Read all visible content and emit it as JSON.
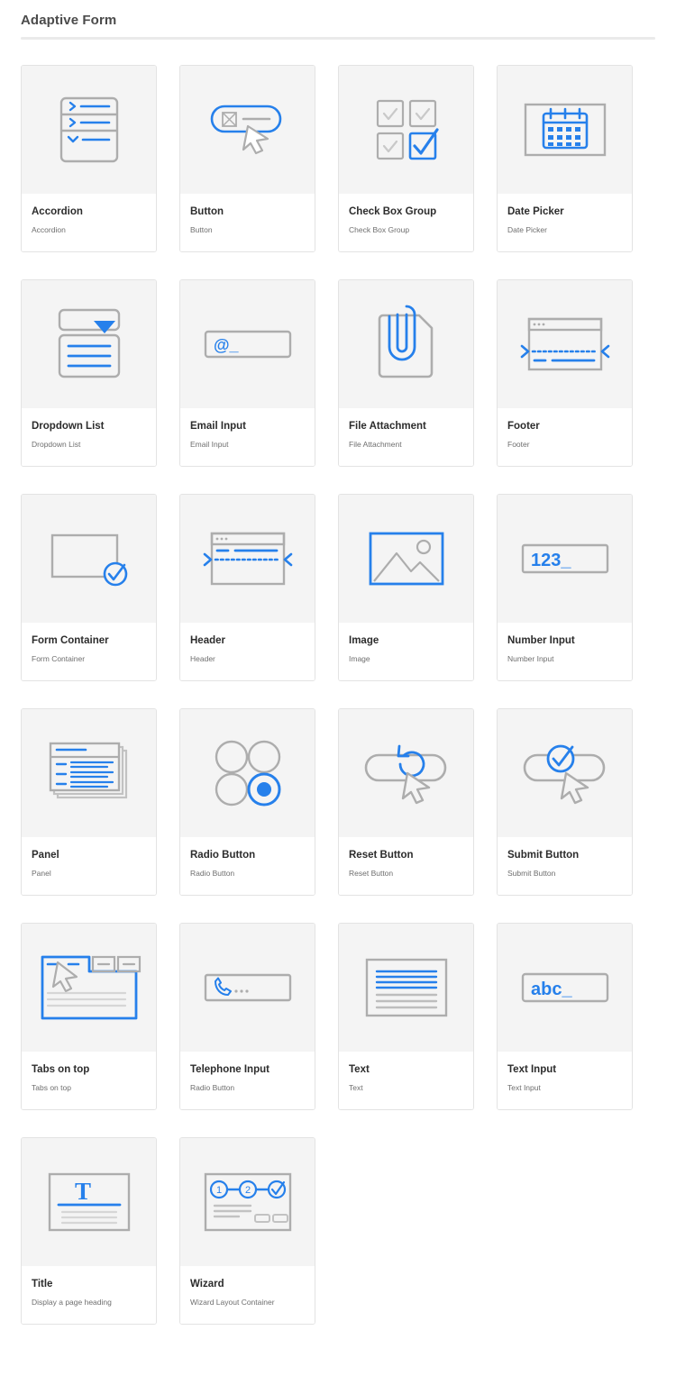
{
  "header": {
    "title": "Adaptive Form"
  },
  "components": [
    {
      "name": "Accordion",
      "description": "Accordion",
      "icon": "accordion-icon"
    },
    {
      "name": "Button",
      "description": "Button",
      "icon": "button-icon"
    },
    {
      "name": "Check Box Group",
      "description": "Check Box Group",
      "icon": "checkbox-group-icon"
    },
    {
      "name": "Date Picker",
      "description": "Date Picker",
      "icon": "date-picker-icon"
    },
    {
      "name": "Dropdown List",
      "description": "Dropdown List",
      "icon": "dropdown-list-icon"
    },
    {
      "name": "Email Input",
      "description": "Email Input",
      "icon": "email-input-icon"
    },
    {
      "name": "File Attachment",
      "description": "File Attachment",
      "icon": "file-attachment-icon"
    },
    {
      "name": "Footer",
      "description": "Footer",
      "icon": "footer-icon"
    },
    {
      "name": "Form Container",
      "description": "Form Container",
      "icon": "form-container-icon"
    },
    {
      "name": "Header",
      "description": "Header",
      "icon": "header-icon"
    },
    {
      "name": "Image",
      "description": "Image",
      "icon": "image-icon"
    },
    {
      "name": "Number Input",
      "description": "Number Input",
      "icon": "number-input-icon"
    },
    {
      "name": "Panel",
      "description": "Panel",
      "icon": "panel-icon"
    },
    {
      "name": "Radio Button",
      "description": "Radio Button",
      "icon": "radio-button-icon"
    },
    {
      "name": "Reset Button",
      "description": "Reset Button",
      "icon": "reset-button-icon"
    },
    {
      "name": "Submit Button",
      "description": "Submit Button",
      "icon": "submit-button-icon"
    },
    {
      "name": "Tabs on top",
      "description": "Tabs on top",
      "icon": "tabs-on-top-icon"
    },
    {
      "name": "Telephone Input",
      "description": "Radio Button",
      "icon": "telephone-input-icon"
    },
    {
      "name": "Text",
      "description": "Text",
      "icon": "text-icon"
    },
    {
      "name": "Text Input",
      "description": "Text Input",
      "icon": "text-input-icon"
    },
    {
      "name": "Title",
      "description": "Display a page heading",
      "icon": "title-icon"
    },
    {
      "name": "Wizard",
      "description": "Wizard Layout Container",
      "icon": "wizard-icon"
    }
  ],
  "icon_text": {
    "number_input": "123_",
    "text_input": "abc_",
    "email_input": "@_",
    "title_glyph": "T",
    "wizard_step_1": "1",
    "wizard_step_2": "2"
  },
  "colors": {
    "accent_blue": "#2680eb",
    "icon_gray": "#adadad",
    "card_border": "#e3e3e3",
    "thumb_bg": "#f4f4f4",
    "title_text": "#4b4b4b",
    "name_text": "#2c2c2c",
    "desc_text": "#6e6e6e"
  }
}
